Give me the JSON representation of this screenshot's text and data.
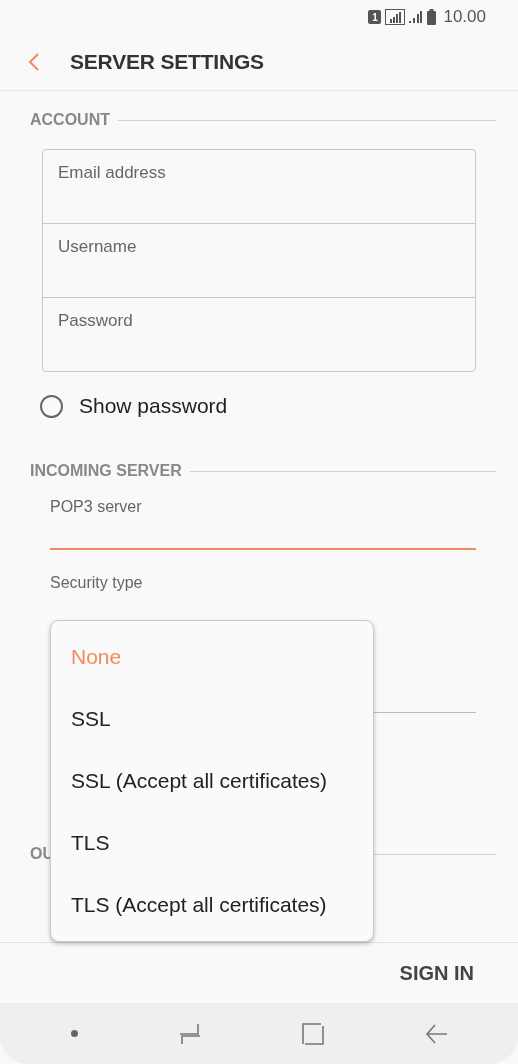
{
  "status_bar": {
    "sim": "1",
    "time": "10.00"
  },
  "header": {
    "title": "SERVER SETTINGS"
  },
  "account": {
    "heading": "ACCOUNT",
    "fields": [
      {
        "placeholder": "Email address"
      },
      {
        "placeholder": "Username"
      },
      {
        "placeholder": "Password"
      }
    ],
    "show_password": {
      "label": "Show password",
      "checked": false
    }
  },
  "incoming": {
    "heading": "INCOMING SERVER",
    "server_label": "POP3 server",
    "server_focused": true,
    "security_label": "Security type"
  },
  "outgoing": {
    "heading": "OU"
  },
  "dropdown": {
    "options": [
      {
        "label": "None",
        "selected": true
      },
      {
        "label": "SSL",
        "selected": false
      },
      {
        "label": "SSL (Accept all certificates)",
        "selected": false
      },
      {
        "label": "TLS",
        "selected": false
      },
      {
        "label": "TLS (Accept all certificates)",
        "selected": false
      }
    ]
  },
  "footer": {
    "button": "SIGN IN"
  }
}
